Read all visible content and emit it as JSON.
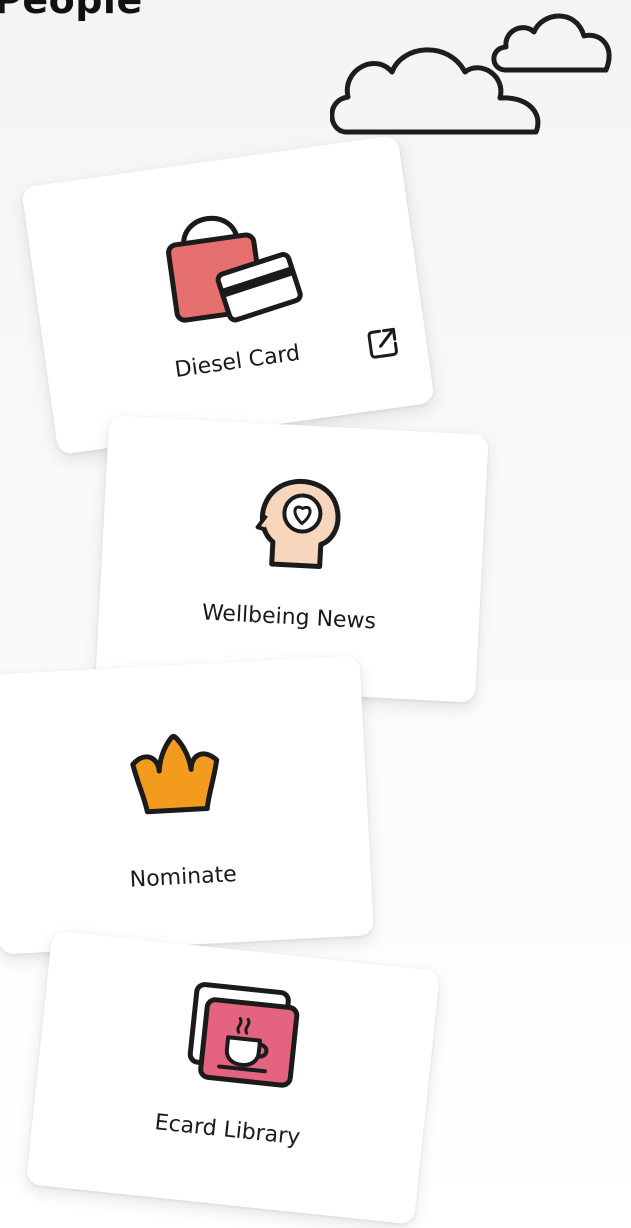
{
  "header": {
    "title": "People"
  },
  "cards": [
    {
      "label": "Diesel Card",
      "icon": "shopping-bag-card-icon",
      "external": true,
      "external_icon": "external-link-icon"
    },
    {
      "label": "Wellbeing News",
      "icon": "head-heart-icon"
    },
    {
      "label": "Nominate",
      "icon": "crown-icon"
    },
    {
      "label": "Ecard Library",
      "icon": "ecard-coffee-icon"
    }
  ],
  "colors": {
    "bag": "#e5706e",
    "head": "#f6d6bd",
    "crown": "#f29b1d",
    "ecard": "#e4637f"
  }
}
